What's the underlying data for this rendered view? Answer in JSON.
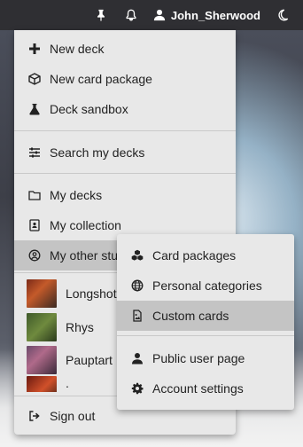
{
  "topbar": {
    "username": "John_Sherwood",
    "icons": [
      "pin-icon",
      "bell-icon",
      "user-icon",
      "moon-icon"
    ]
  },
  "menu": {
    "items": [
      {
        "label": "New deck",
        "icon": "plus-icon"
      },
      {
        "label": "New card package",
        "icon": "cube-icon"
      },
      {
        "label": "Deck sandbox",
        "icon": "flask-icon"
      },
      {
        "label": "Search my decks",
        "icon": "sliders-icon"
      },
      {
        "label": "My decks",
        "icon": "folder-icon"
      },
      {
        "label": "My collection",
        "icon": "contact-book-icon"
      },
      {
        "label": "My other stu",
        "icon": "user-circle-icon"
      }
    ],
    "decks": [
      "Longshot",
      "Rhys",
      "Pauptart",
      "."
    ],
    "sign_out": {
      "label": "Sign out",
      "icon": "sign-out-icon"
    }
  },
  "submenu": {
    "items": [
      {
        "label": "Card packages",
        "icon": "cubes-icon"
      },
      {
        "label": "Personal categories",
        "icon": "globe-icon"
      },
      {
        "label": "Custom cards",
        "icon": "image-file-icon"
      },
      {
        "label": "Public user page",
        "icon": "user-icon"
      },
      {
        "label": "Account settings",
        "icon": "gear-icon"
      }
    ]
  }
}
